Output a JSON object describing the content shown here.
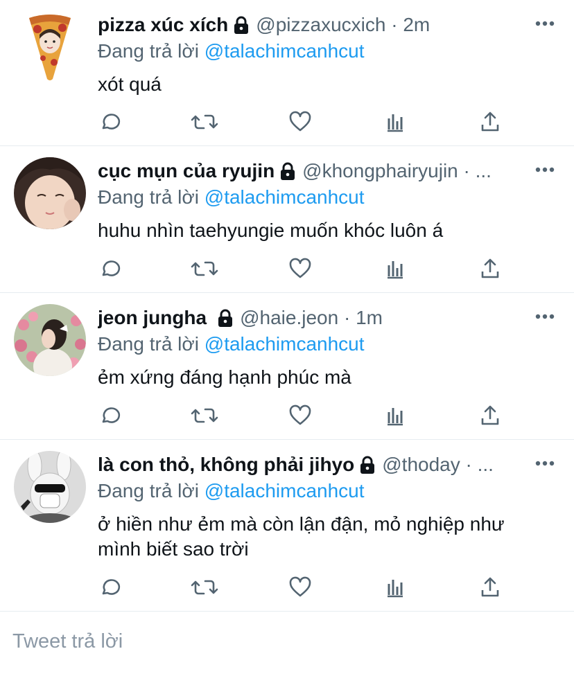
{
  "reply_prefix": "Đang trả lời",
  "tweets": [
    {
      "name": "pizza xúc xích",
      "handle": "@pizzaxucxich · 2m",
      "reply_to": "@talachimcanhcut",
      "text": "xót quá",
      "avatar": "pizza-avatar"
    },
    {
      "name": "cục mụn của ryujin",
      "handle": "@khongphairyujin · ...",
      "reply_to": "@talachimcanhcut",
      "text": "huhu nhìn taehyungie muốn khóc luôn á",
      "avatar": "photo-avatar"
    },
    {
      "name": "jeon jungha",
      "handle": "@haie.jeon · 1m",
      "reply_to": "@talachimcanhcut",
      "text": "ẻm xứng đáng hạnh phúc mà",
      "avatar": "photo-avatar"
    },
    {
      "name": "là con thỏ, không phải jihyo",
      "handle": "@thoday · ...",
      "reply_to": "@talachimcanhcut",
      "text_line1": "ở hiền như ẻm mà còn lận đận, mỏ nghiệp như",
      "text_line2": "mình biết sao trời",
      "avatar": "photo-avatar"
    }
  ],
  "compose": {
    "placeholder": "Tweet trả lời"
  },
  "colors": {
    "accent": "#1d9bf0",
    "muted": "#536471",
    "icon": "#536471",
    "divider": "#e6ecf0"
  }
}
